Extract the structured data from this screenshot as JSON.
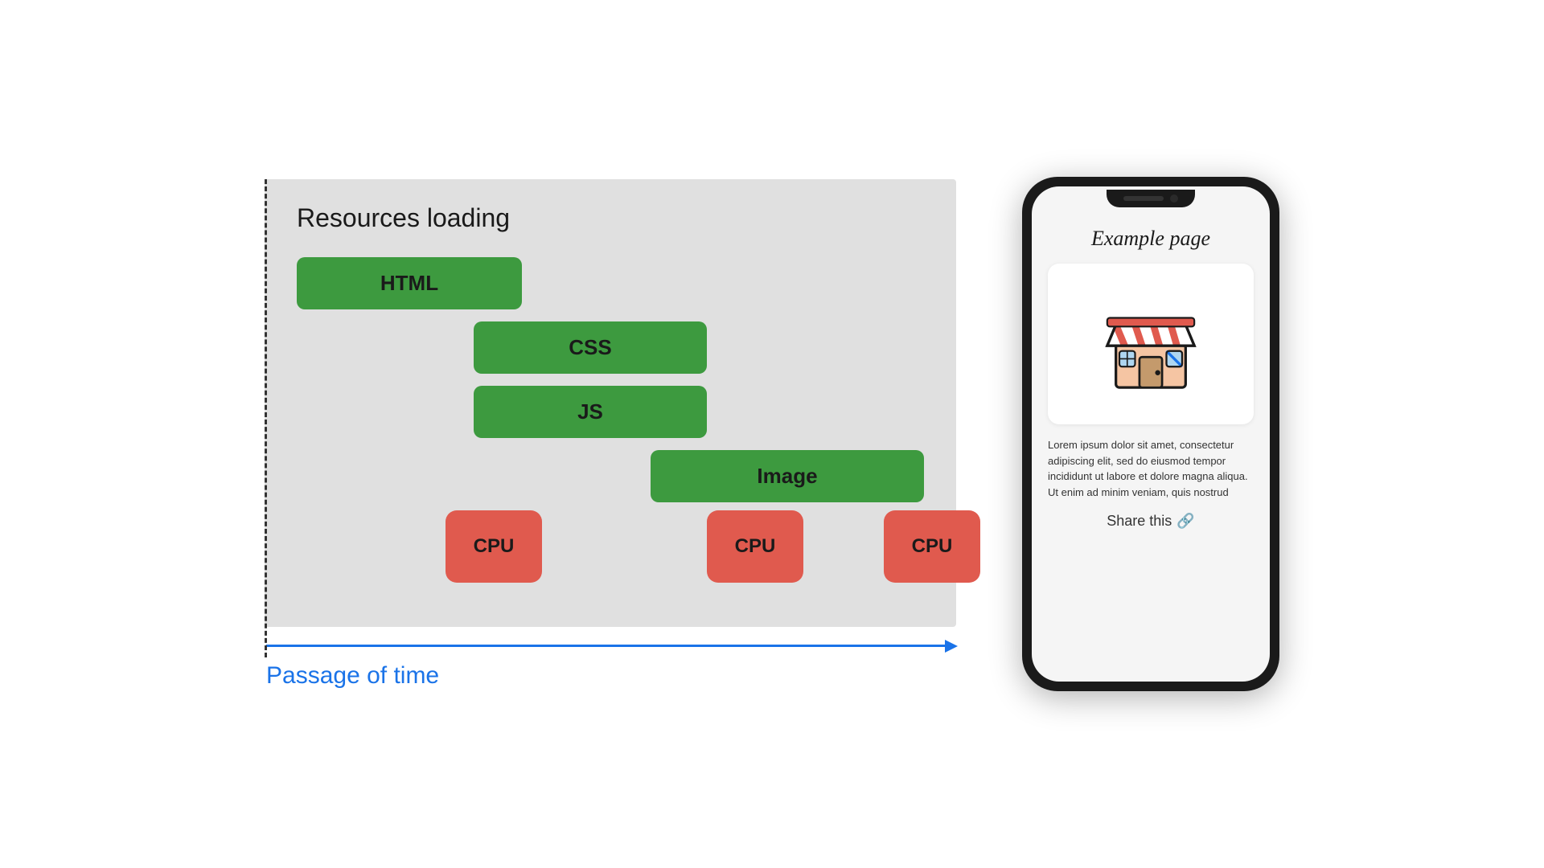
{
  "diagram": {
    "title": "Resources loading",
    "bars": {
      "html": "HTML",
      "css": "CSS",
      "js": "JS",
      "image": "Image"
    },
    "cpu": {
      "label": "CPU"
    },
    "time": {
      "label": "Passage of time"
    }
  },
  "phone": {
    "title": "Example page",
    "body_text": "Lorem ipsum dolor sit amet, consectetur adipiscing elit, sed do eiusmod tempor incididunt ut labore et dolore magna aliqua. Ut enim ad minim veniam, quis nostrud",
    "share": {
      "label": "Share this"
    }
  },
  "colors": {
    "green": "#3d9a3f",
    "red": "#e05a4e",
    "blue": "#1a73e8",
    "dark": "#1a1a1a"
  }
}
